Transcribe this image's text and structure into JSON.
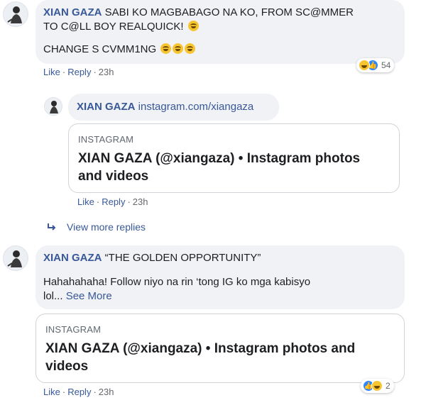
{
  "comment1": {
    "author": "XIAN GAZA",
    "line1": "SABI KO MAGBABAGO NA KO, FROM SC@MMER",
    "line2": "TO C@LL BOY REALQUICK!",
    "line3": "CHANGE S CVMM1NG",
    "like": "Like",
    "reply": "Reply",
    "time": "23h",
    "reaction_count": "54",
    "reactions": [
      "haha",
      "like"
    ]
  },
  "reply1": {
    "author": "XIAN GAZA",
    "link_text": "instagram.com/xiangaza",
    "card_source": "INSTAGRAM",
    "card_title_line1": "XIAN GAZA (@xiangaza) • Instagram photos",
    "card_title_line2": "and videos",
    "like": "Like",
    "reply": "Reply",
    "time": "23h"
  },
  "view_more": "View more replies",
  "comment2": {
    "author": "XIAN GAZA",
    "headline": "“THE GOLDEN OPPORTUNITY”",
    "line1": "Hahahahaha! Follow niyo na rin ‘tong IG ko mga kabisyo",
    "line2": "lol...",
    "see_more": "See More",
    "card_source": "INSTAGRAM",
    "card_title_line1": "XIAN GAZA (@xiangaza) • Instagram photos and",
    "card_title_line2": "videos",
    "like": "Like",
    "reply": "Reply",
    "time": "23h",
    "reaction_count": "2",
    "reactions": [
      "like",
      "haha"
    ]
  },
  "colors": {
    "link": "#385898",
    "bubble": "#f0f2f5",
    "like_blue": "#2d88ff",
    "haha_yellow": "#f7c531"
  }
}
